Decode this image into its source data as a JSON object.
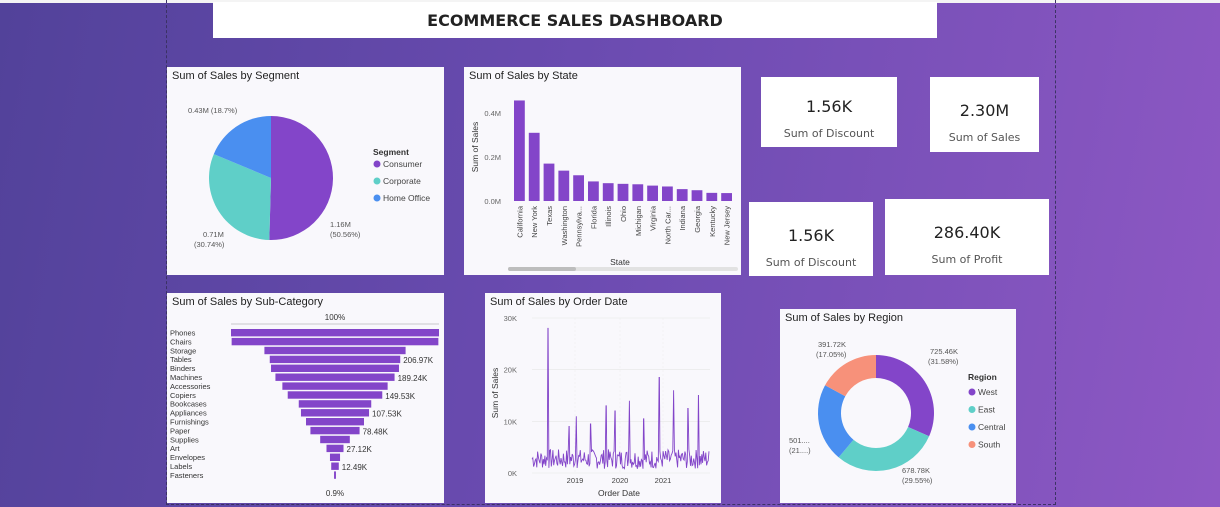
{
  "dashboard": {
    "title": "ECOMMERCE SALES DASHBOARD"
  },
  "kpis": [
    {
      "value": "1.56K",
      "label": "Sum of Discount"
    },
    {
      "value": "2.30M",
      "label": "Sum of Sales"
    },
    {
      "value": "1.56K",
      "label": "Sum of Discount"
    },
    {
      "value": "286.40K",
      "label": "Sum of Profit"
    }
  ],
  "colors": {
    "purple": "#8345c9",
    "teal": "#5fcfc8",
    "blue": "#4a8ff0",
    "salmon": "#f7917a"
  },
  "chart_data": [
    {
      "type": "pie",
      "title": "Sum of Sales by Segment",
      "legend_title": "Segment",
      "legend_position": "right",
      "slices": [
        {
          "name": "Consumer",
          "value": 1.16,
          "label": "1.16M",
          "pct": "(50.56%)",
          "color": "#8345c9"
        },
        {
          "name": "Corporate",
          "value": 0.71,
          "label": "0.71M",
          "pct": "(30.74%)",
          "color": "#5fcfc8"
        },
        {
          "name": "Home Office",
          "value": 0.43,
          "label": "0.43M (18.7%)",
          "pct": "",
          "color": "#4a8ff0"
        }
      ]
    },
    {
      "type": "bar",
      "title": "Sum of Sales by State",
      "xlabel": "State",
      "ylabel": "Sum of Sales",
      "yticks": [
        "0.0M",
        "0.2M",
        "0.4M"
      ],
      "ylim": [
        0,
        0.5
      ],
      "categories": [
        "California",
        "New York",
        "Texas",
        "Washington",
        "Pennsylva...",
        "Florida",
        "Illinois",
        "Ohio",
        "Michigan",
        "Virginia",
        "North Car...",
        "Indiana",
        "Georgia",
        "Kentucky",
        "New Jersey"
      ],
      "values": [
        0.457,
        0.31,
        0.17,
        0.138,
        0.117,
        0.089,
        0.081,
        0.078,
        0.076,
        0.07,
        0.066,
        0.054,
        0.049,
        0.037,
        0.036
      ]
    },
    {
      "type": "bar",
      "subtype": "funnel",
      "title": "Sum of Sales by Sub-Category",
      "top_label": "100%",
      "bottom_label": "0.9%",
      "categories": [
        "Phones",
        "Chairs",
        "Storage",
        "Tables",
        "Binders",
        "Machines",
        "Accessories",
        "Copiers",
        "Bookcases",
        "Appliances",
        "Furnishings",
        "Paper",
        "Supplies",
        "Art",
        "Envelopes",
        "Labels",
        "Fasteners"
      ],
      "values": [
        330,
        328,
        224,
        207,
        203,
        189,
        167,
        150,
        115,
        108,
        92,
        78,
        47,
        27,
        16,
        12,
        3
      ],
      "data_labels": {
        "3": "206.97K",
        "5": "189.24K",
        "7": "149.53K",
        "9": "107.53K",
        "11": "78.48K",
        "13": "27.12K",
        "15": "12.49K"
      }
    },
    {
      "type": "line",
      "title": "Sum of Sales by Order Date",
      "xlabel": "Order Date",
      "ylabel": "Sum of Sales",
      "yticks": [
        "0K",
        "10K",
        "20K",
        "30K"
      ],
      "ylim": [
        0,
        30000
      ],
      "xticks": [
        "2019",
        "2020",
        "2021"
      ],
      "spikes": [
        {
          "t": 0.09,
          "v": 28000
        },
        {
          "t": 0.21,
          "v": 9000
        },
        {
          "t": 0.25,
          "v": 11000
        },
        {
          "t": 0.33,
          "v": 9500
        },
        {
          "t": 0.42,
          "v": 13000
        },
        {
          "t": 0.47,
          "v": 12000
        },
        {
          "t": 0.55,
          "v": 14000
        },
        {
          "t": 0.63,
          "v": 10500
        },
        {
          "t": 0.72,
          "v": 18500
        },
        {
          "t": 0.8,
          "v": 16000
        },
        {
          "t": 0.88,
          "v": 12500
        },
        {
          "t": 0.94,
          "v": 15000
        }
      ]
    },
    {
      "type": "pie",
      "subtype": "donut",
      "title": "Sum of Sales by Region",
      "legend_title": "Region",
      "legend_position": "right",
      "slices": [
        {
          "name": "West",
          "value": 725.46,
          "label": "725.46K",
          "pct": "(31.58%)",
          "color": "#8345c9"
        },
        {
          "name": "East",
          "value": 678.78,
          "label": "678.78K",
          "pct": "(29.55%)",
          "color": "#5fcfc8"
        },
        {
          "name": "Central",
          "value": 501.24,
          "label": "501....",
          "pct": "(21....)",
          "color": "#4a8ff0"
        },
        {
          "name": "South",
          "value": 391.72,
          "label": "391.72K",
          "pct": "(17.05%)",
          "color": "#f7917a"
        }
      ]
    }
  ]
}
